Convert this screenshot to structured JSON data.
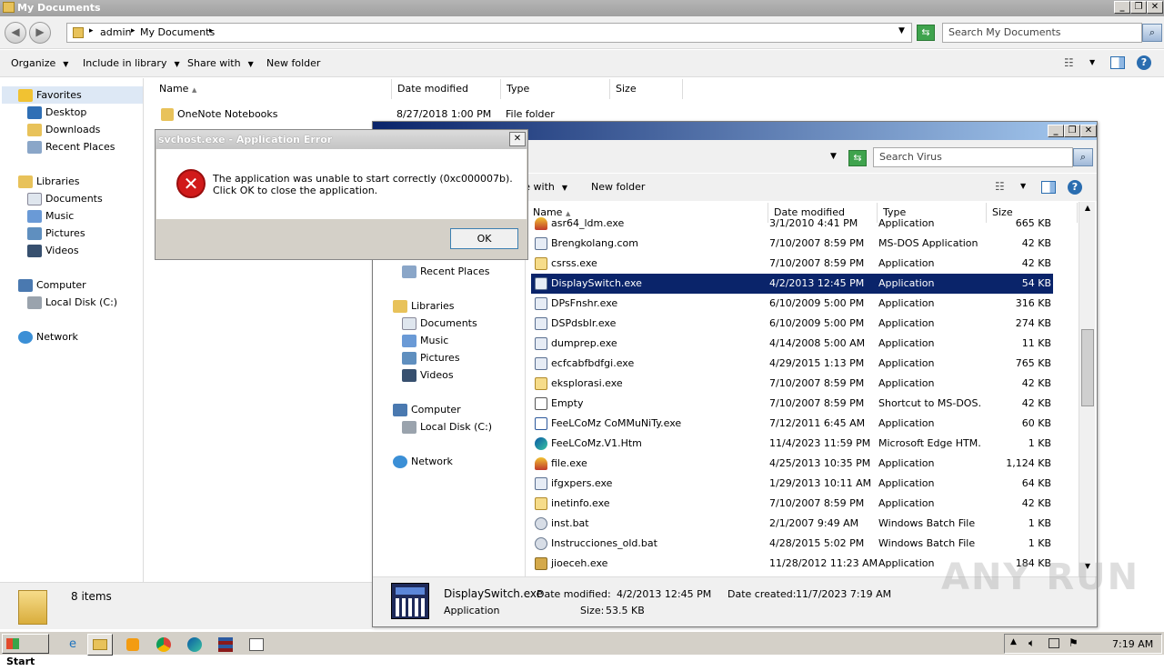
{
  "main_window": {
    "title": "My Documents",
    "breadcrumb": [
      "admin",
      "My Documents"
    ],
    "search_placeholder": "Search My Documents",
    "toolbar": {
      "organize": "Organize",
      "include": "Include in library",
      "share": "Share with",
      "new_folder": "New folder"
    },
    "nav": {
      "favorites": "Favorites",
      "desktop": "Desktop",
      "downloads": "Downloads",
      "recent": "Recent Places",
      "libraries": "Libraries",
      "documents": "Documents",
      "music": "Music",
      "pictures": "Pictures",
      "videos": "Videos",
      "computer": "Computer",
      "local_disk": "Local Disk (C:)",
      "network": "Network"
    },
    "columns": {
      "name": "Name",
      "date": "Date modified",
      "type": "Type",
      "size": "Size"
    },
    "rows": [
      {
        "name": "OneNote Notebooks",
        "date": "8/27/2018 1:00 PM",
        "type": "File folder",
        "size": ""
      }
    ],
    "status": "8 items"
  },
  "virus_window": {
    "search_placeholder": "Search Virus",
    "toolbar": {
      "share": "re with",
      "new_folder": "New folder"
    },
    "nav": {
      "recent": "Recent Places",
      "libraries": "Libraries",
      "documents": "Documents",
      "music": "Music",
      "pictures": "Pictures",
      "videos": "Videos",
      "computer": "Computer",
      "local_disk": "Local Disk (C:)",
      "network": "Network"
    },
    "columns": {
      "name": "Name",
      "date": "Date modified",
      "type": "Type",
      "size": "Size"
    },
    "rows": [
      {
        "name": "asr64_ldm.exe",
        "date": "3/1/2010 4:41 PM",
        "type": "Application",
        "size": "665 KB",
        "icon": "shield"
      },
      {
        "name": "Brengkolang.com",
        "date": "7/10/2007 8:59 PM",
        "type": "MS-DOS Application",
        "size": "42 KB",
        "icon": "app"
      },
      {
        "name": "csrss.exe",
        "date": "7/10/2007 8:59 PM",
        "type": "Application",
        "size": "42 KB",
        "icon": "folder"
      },
      {
        "name": "DisplaySwitch.exe",
        "date": "4/2/2013 12:45 PM",
        "type": "Application",
        "size": "54 KB",
        "icon": "app",
        "selected": true
      },
      {
        "name": "DPsFnshr.exe",
        "date": "6/10/2009 5:00 PM",
        "type": "Application",
        "size": "316 KB",
        "icon": "app"
      },
      {
        "name": "DSPdsblr.exe",
        "date": "6/10/2009 5:00 PM",
        "type": "Application",
        "size": "274 KB",
        "icon": "app"
      },
      {
        "name": "dumprep.exe",
        "date": "4/14/2008 5:00 AM",
        "type": "Application",
        "size": "11 KB",
        "icon": "app"
      },
      {
        "name": "ecfcabfbdfgi.exe",
        "date": "4/29/2015 1:13 PM",
        "type": "Application",
        "size": "765 KB",
        "icon": "app"
      },
      {
        "name": "eksplorasi.exe",
        "date": "7/10/2007 8:59 PM",
        "type": "Application",
        "size": "42 KB",
        "icon": "folder"
      },
      {
        "name": "Empty",
        "date": "7/10/2007 8:59 PM",
        "type": "Shortcut to MS-DOS…",
        "size": "42 KB",
        "icon": "shortcut"
      },
      {
        "name": "FeeLCoMz CoMMuNiTy.exe",
        "date": "7/12/2011 6:45 AM",
        "type": "Application",
        "size": "60 KB",
        "icon": "word"
      },
      {
        "name": "FeeLCoMz.V1.Htm",
        "date": "11/4/2023 11:59 PM",
        "type": "Microsoft Edge HTM…",
        "size": "1 KB",
        "icon": "edge"
      },
      {
        "name": "file.exe",
        "date": "4/25/2013 10:35 PM",
        "type": "Application",
        "size": "1,124 KB",
        "icon": "shield"
      },
      {
        "name": "ifgxpers.exe",
        "date": "1/29/2013 10:11 AM",
        "type": "Application",
        "size": "64 KB",
        "icon": "app"
      },
      {
        "name": "inetinfo.exe",
        "date": "7/10/2007 8:59 PM",
        "type": "Application",
        "size": "42 KB",
        "icon": "folder"
      },
      {
        "name": "inst.bat",
        "date": "2/1/2007 9:49 AM",
        "type": "Windows Batch File",
        "size": "1 KB",
        "icon": "gear"
      },
      {
        "name": "Instrucciones_old.bat",
        "date": "4/28/2015 5:02 PM",
        "type": "Windows Batch File",
        "size": "1 KB",
        "icon": "gear"
      },
      {
        "name": "jioeceh.exe",
        "date": "11/28/2012 11:23 AM",
        "type": "Application",
        "size": "184 KB",
        "icon": "bag"
      }
    ],
    "details": {
      "name": "DisplaySwitch.exe",
      "type": "Application",
      "modified_label": "Date modified:",
      "modified": "4/2/2013 12:45 PM",
      "size_label": "Size:",
      "size": "53.5 KB",
      "created_label": "Date created:",
      "created": "11/7/2023 7:19 AM"
    }
  },
  "dialog": {
    "title": "svchost.exe - Application Error",
    "message": "The application was unable to start correctly (0xc000007b). Click OK to close the application.",
    "ok": "OK",
    "close": "✕"
  },
  "taskbar": {
    "start": "Start",
    "clock": "7:19 AM"
  },
  "watermark": "ANY RUN",
  "colors": {
    "selection": "#0a246a",
    "error": "#d11a1a",
    "taskbar": "#d4d0c8"
  }
}
